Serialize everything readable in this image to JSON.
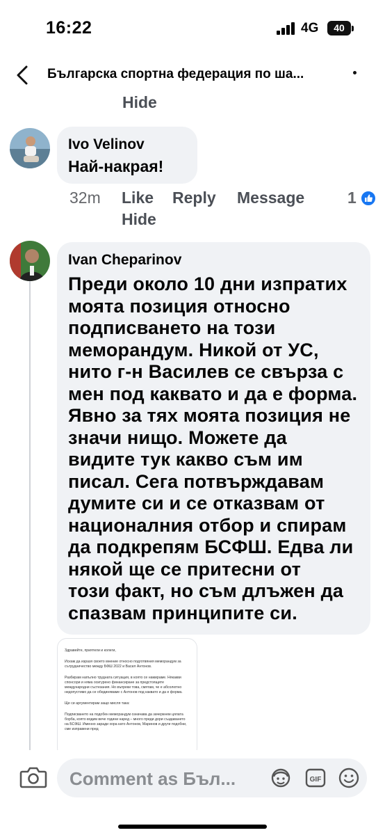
{
  "status": {
    "time": "16:22",
    "network": "4G",
    "battery": "40"
  },
  "header": {
    "title": "Българска спортна федерация по ша..."
  },
  "previous_comment": {
    "hide_label": "Hide"
  },
  "comment1": {
    "author": "Ivo Velinov",
    "text": "Най-накрая!",
    "time": "32m",
    "like": "Like",
    "reply": "Reply",
    "message": "Message",
    "reaction_count": "1",
    "hide": "Hide"
  },
  "comment2": {
    "author": "Ivan Cheparinov",
    "lines": [
      "Преди около 10 дни изпратих",
      "моята позиция относно",
      "подписването на този",
      "меморандум. Никой от УС,",
      "нито г-н Василев се свърза с",
      "мен под каквато и да е форма.",
      "Явно за тях моята позиция не",
      "значи нищо. Можете да",
      "видите тук какво съм им",
      "писал. Сега потвърждавам",
      "думите си и се отказвам от",
      "националния отбор и спирам",
      "да подкрепям БСФШ. Едва ли",
      "някой ще се притесни от",
      "този факт, но съм длъжен да",
      "спазвам принципите си."
    ]
  },
  "attachment": {
    "paragraphs": [
      "Здравейте, приятели и колеги,",
      "Искам да изразя своето мнение относно подготвяния меморандум за сътрудничество между БФШ 2022 и Васил Антонов.",
      "Разбирам напълно трудната ситуация, в която се намираме. Някакви спонсори и няма осигурено финансиране за предстоящите международни състезания. Но въпреки това, смятам, че е абсолютно недопустимо да се обединяваме с Антонов под каквато и да е форма.",
      "Ще си аргументирам защо мисля така:",
      "Подписването на подобен меморандум означава да зачеркнем цялата борба, която водим вече години наред – много преди дори създаването на БСФШ. Именно заради хора като Антонов, Маринов и други подобни, сме изправени пред"
    ]
  },
  "bottom": {
    "placeholder": "Comment as Бъл..."
  }
}
